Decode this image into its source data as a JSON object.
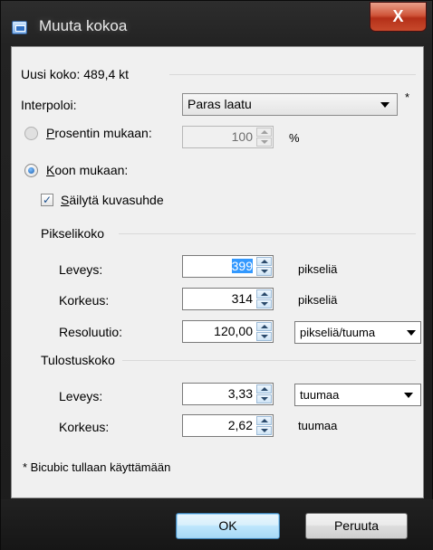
{
  "window": {
    "title": "Muuta kokoa",
    "close_label": "X"
  },
  "new_size": {
    "label": "Uusi koko: 489,4 kt"
  },
  "interpolation": {
    "label": "Interpoloi:",
    "value": "Paras laatu",
    "asterisk": "*"
  },
  "by_percent": {
    "label_prefix": "",
    "label_underlined": "P",
    "label_rest": "rosentin mukaan:",
    "value": "100",
    "unit": "%",
    "selected": false
  },
  "by_size": {
    "label_underlined": "K",
    "label_rest": "oon mukaan:",
    "selected": true
  },
  "keep_ratio": {
    "label_underlined": "S",
    "label_rest": "äilytä kuvasuhde",
    "checked": true,
    "check_glyph": "✓"
  },
  "pixel_size": {
    "heading": "Pikselikoko",
    "width": {
      "label": "Leveys:",
      "value": "399",
      "unit": "pikseliä"
    },
    "height": {
      "label": "Korkeus:",
      "value": "314",
      "unit": "pikseliä"
    },
    "resolution": {
      "label": "Resoluutio:",
      "value": "120,00",
      "unit": "pikseliä/tuuma"
    }
  },
  "print_size": {
    "heading": "Tulostuskoko",
    "width": {
      "label": "Leveys:",
      "value": "3,33",
      "unit": "tuumaa"
    },
    "height": {
      "label": "Korkeus:",
      "value": "2,62",
      "unit": "tuumaa"
    }
  },
  "footnote": "* Bicubic tullaan käyttämään",
  "buttons": {
    "ok": "OK",
    "cancel": "Peruuta"
  }
}
